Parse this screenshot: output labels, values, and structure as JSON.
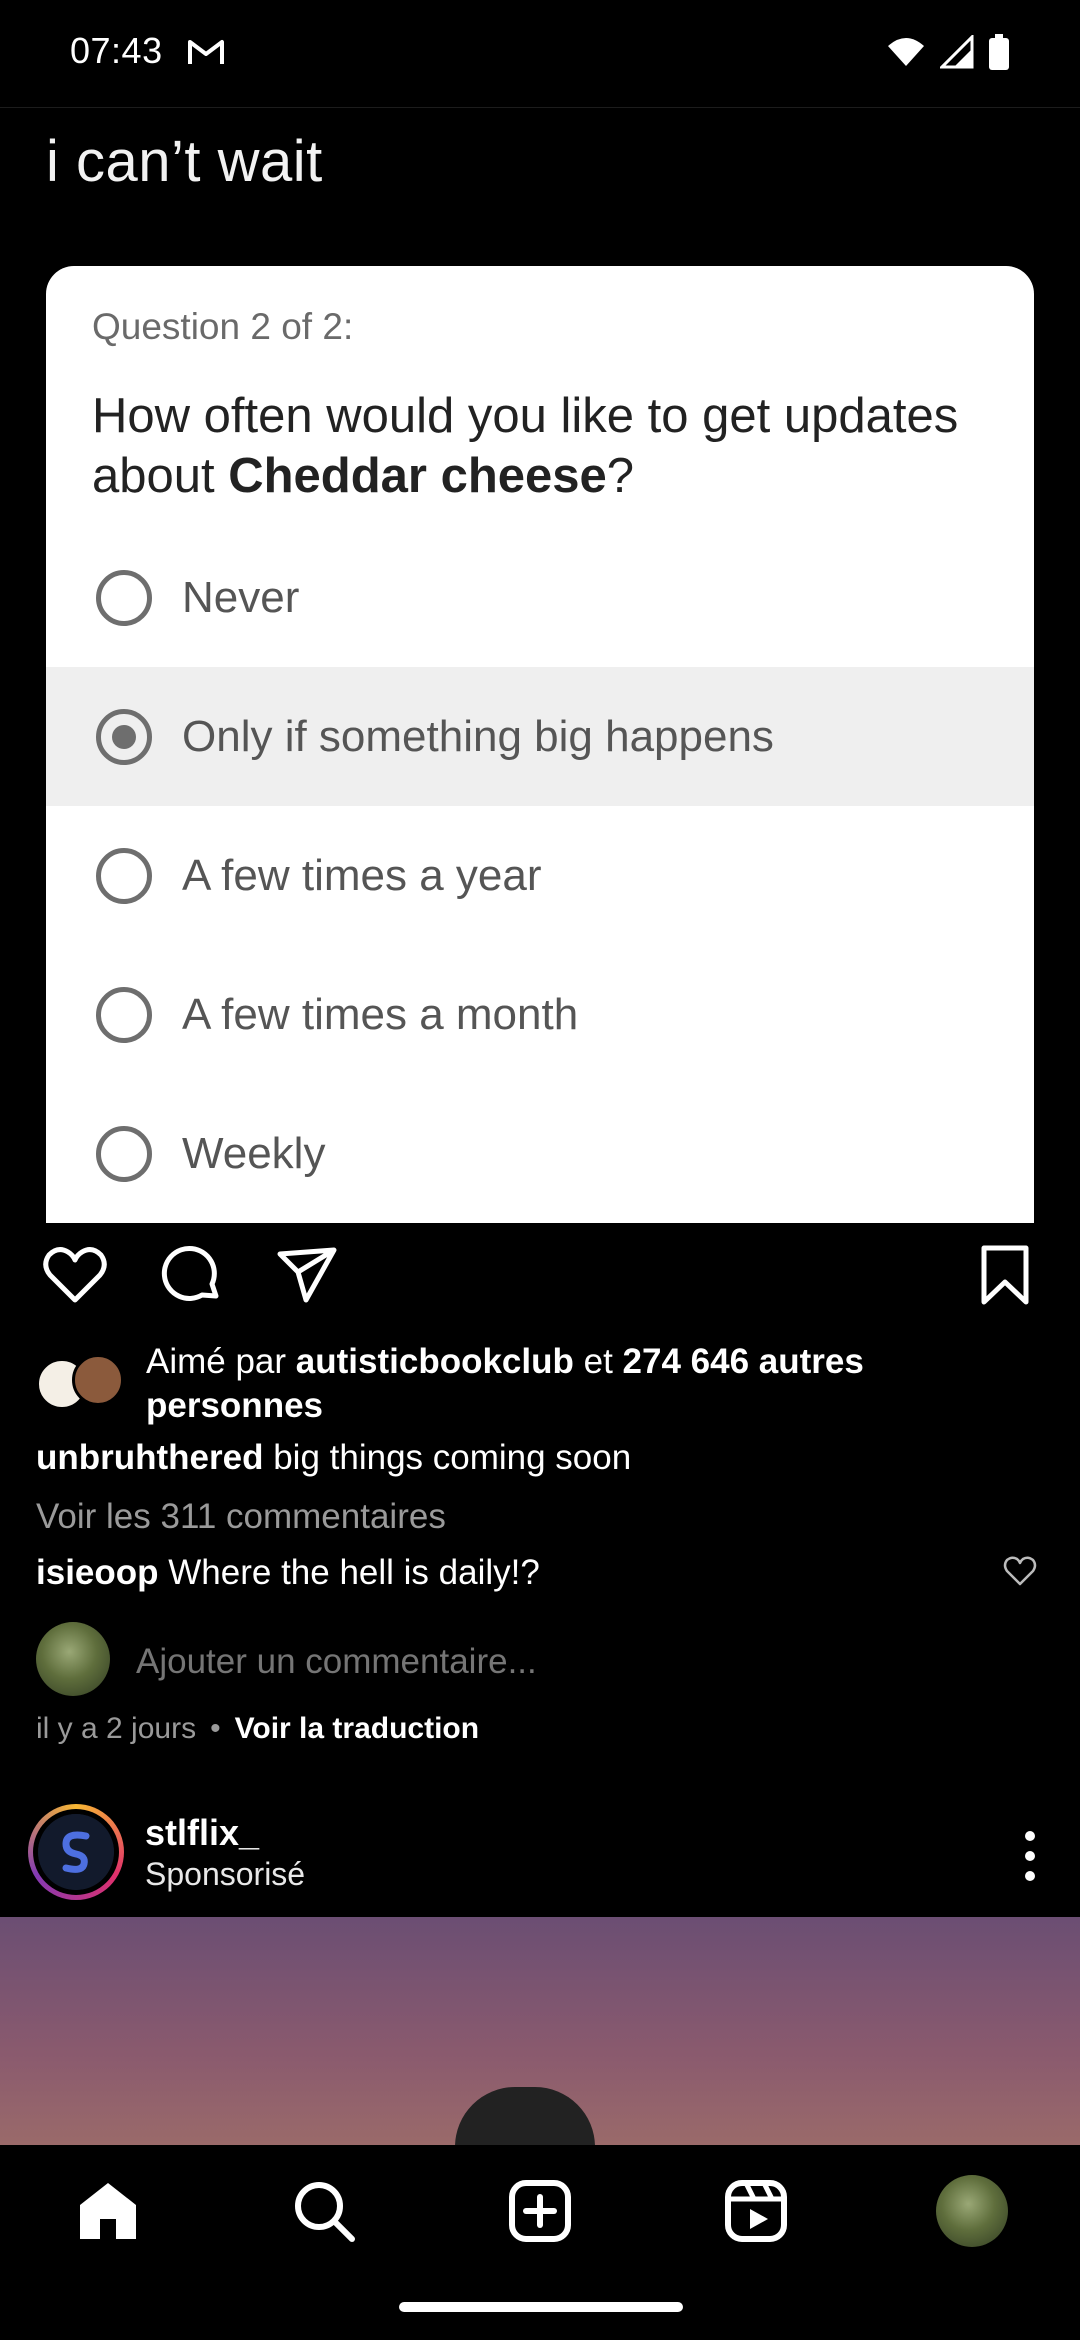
{
  "status_bar": {
    "time": "07:43",
    "icons": [
      "gmail-icon",
      "wifi-icon",
      "signal-icon",
      "battery-icon"
    ]
  },
  "post": {
    "media": {
      "meme_caption": "i can’t wait",
      "survey": {
        "question_number": "Question 2 of 2:",
        "question_prefix": "How often would you like to get updates about ",
        "question_bold": "Cheddar cheese",
        "question_suffix": "?",
        "options": [
          {
            "label": "Never",
            "selected": false
          },
          {
            "label": "Only if something big happens",
            "selected": true
          },
          {
            "label": "A few times a year",
            "selected": false
          },
          {
            "label": "A few times a month",
            "selected": false
          },
          {
            "label": "Weekly",
            "selected": false
          }
        ]
      }
    },
    "likes": {
      "prefix": "Aimé par ",
      "user": "autisticbookclub",
      "middle": " et ",
      "count": "274 646 autres personnes"
    },
    "caption": {
      "user": "unbruhthered",
      "text": " big things coming soon"
    },
    "view_comments": "Voir les 311 commentaires",
    "comment": {
      "user": "isieoop",
      "text": " Where the hell is daily!?"
    },
    "add_comment_placeholder": "Ajouter un commentaire...",
    "time_ago": "il y a 2 jours",
    "translate": "Voir la traduction"
  },
  "next_post": {
    "username": "stlflix_",
    "subtitle": "Sponsorisé"
  },
  "bottom_nav": [
    "home-icon",
    "search-icon",
    "create-icon",
    "reels-icon",
    "profile-avatar"
  ],
  "colors": {
    "background": "#000000",
    "card": "#ffffff",
    "selected_row": "#efefef",
    "muted_text": "#9a9a9a"
  }
}
